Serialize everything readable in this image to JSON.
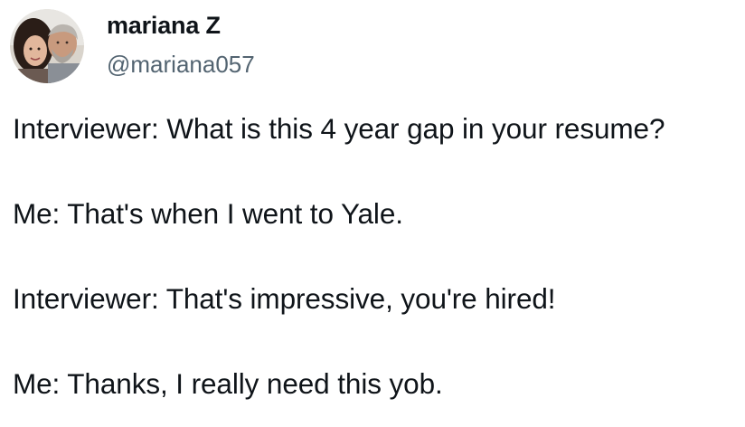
{
  "author": {
    "display_name": "mariana Z",
    "handle": "@mariana057",
    "avatar_icon": "profile-photo-avatar"
  },
  "tweet": {
    "lines": [
      "Interviewer: What is this 4 year gap in your resume?",
      "Me: That's when I went to Yale.",
      "Interviewer: That's impressive, you're hired!",
      "Me: Thanks, I really need this yob."
    ]
  },
  "colors": {
    "text_primary": "#0f1419",
    "text_secondary": "#536471",
    "background": "#ffffff"
  }
}
